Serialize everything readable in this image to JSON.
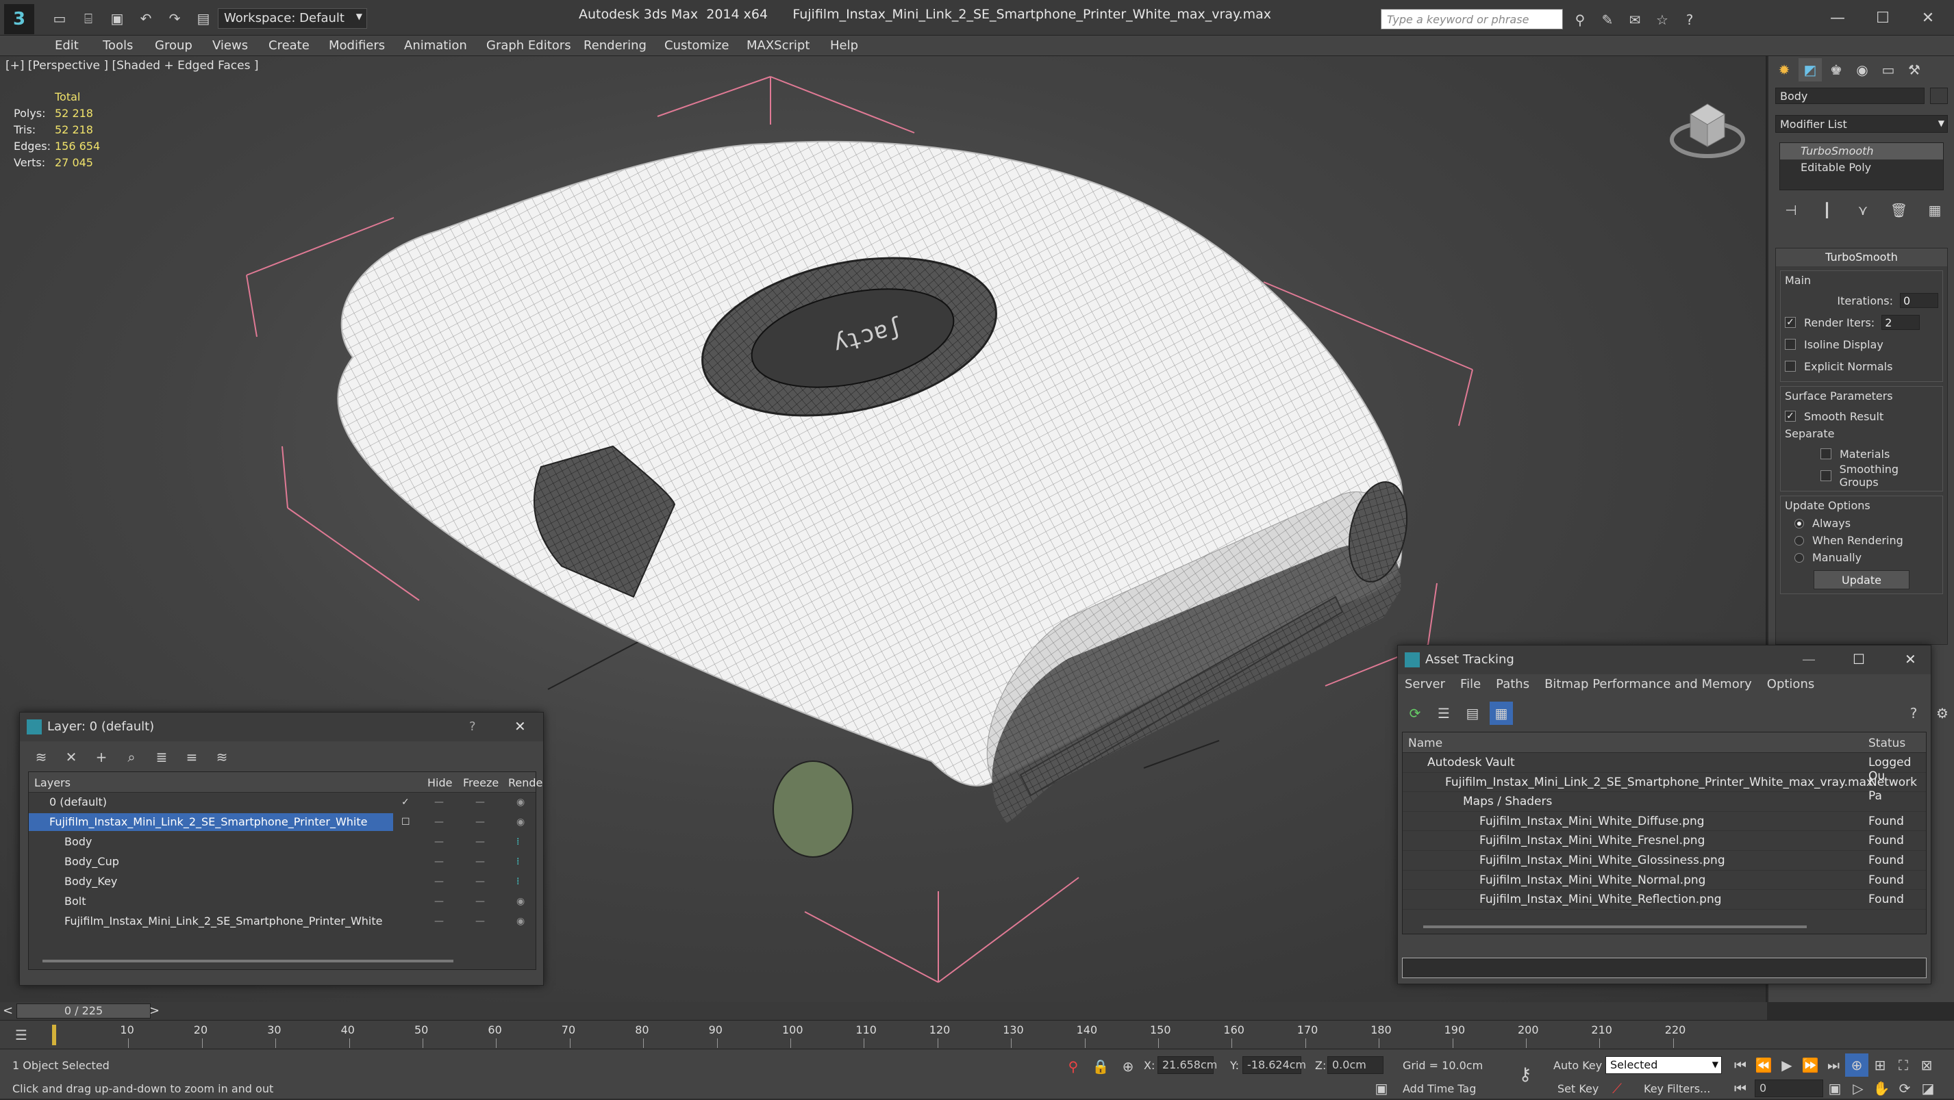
{
  "titlebar": {
    "workspace": "Workspace: Default",
    "app_title": "Autodesk 3ds Max  2014 x64",
    "file_title": "Fujifilm_Instax_Mini_Link_2_SE_Smartphone_Printer_White_max_vray.max",
    "search_placeholder": "Type a keyword or phrase"
  },
  "menu": [
    "Edit",
    "Tools",
    "Group",
    "Views",
    "Create",
    "Modifiers",
    "Animation",
    "Graph Editors",
    "Rendering",
    "Customize",
    "MAXScript",
    "Help"
  ],
  "viewport": {
    "label": "[+] [Perspective ] [Shaded + Edged Faces ]",
    "stats_header": "Total",
    "stats": [
      {
        "label": "Polys:",
        "value": "52 218"
      },
      {
        "label": "Tris:",
        "value": "52 218"
      },
      {
        "label": "Edges:",
        "value": "156 654"
      },
      {
        "label": "Verts:",
        "value": "27 045"
      }
    ]
  },
  "command_panel": {
    "object_name": "Body",
    "modifier_list": "Modifier List",
    "stack": [
      "TurboSmooth",
      "Editable Poly"
    ],
    "turbosmooth": {
      "title": "TurboSmooth",
      "main_label": "Main",
      "iterations_label": "Iterations:",
      "iterations_value": "0",
      "render_iters_label": "Render Iters:",
      "render_iters_value": "2",
      "isoline_label": "Isoline Display",
      "explicit_normals_label": "Explicit Normals",
      "surface_params_label": "Surface Parameters",
      "smooth_result_label": "Smooth Result",
      "separate_label": "Separate",
      "materials_label": "Materials",
      "smoothing_groups_label": "Smoothing Groups",
      "update_options_label": "Update Options",
      "always_label": "Always",
      "when_rendering_label": "When Rendering",
      "manually_label": "Manually",
      "update_button": "Update"
    }
  },
  "layer_dialog": {
    "title": "Layer: 0 (default)",
    "help": "?",
    "columns": {
      "layers": "Layers",
      "hide": "Hide",
      "freeze": "Freeze",
      "render": "Rende"
    },
    "rows": [
      {
        "name": "0 (default)",
        "indent": 0
      },
      {
        "name": "Fujifilm_Instax_Mini_Link_2_SE_Smartphone_Printer_White",
        "indent": 0
      },
      {
        "name": "Body",
        "indent": 1
      },
      {
        "name": "Body_Cup",
        "indent": 1
      },
      {
        "name": "Body_Key",
        "indent": 1
      },
      {
        "name": "Bolt",
        "indent": 1
      },
      {
        "name": "Fujifilm_Instax_Mini_Link_2_SE_Smartphone_Printer_White",
        "indent": 1
      }
    ]
  },
  "asset_dialog": {
    "title": "Asset Tracking",
    "menu": [
      "Server",
      "File",
      "Paths",
      "Bitmap Performance and Memory",
      "Options"
    ],
    "columns": {
      "name": "Name",
      "status": "Status"
    },
    "rows": [
      {
        "name": "Autodesk Vault",
        "status": "Logged Ou"
      },
      {
        "name": "Fujifilm_Instax_Mini_Link_2_SE_Smartphone_Printer_White_max_vray.max",
        "status": "Network Pa"
      },
      {
        "name": "Maps / Shaders",
        "status": ""
      },
      {
        "name": "Fujifilm_Instax_Mini_White_Diffuse.png",
        "status": "Found"
      },
      {
        "name": "Fujifilm_Instax_Mini_White_Fresnel.png",
        "status": "Found"
      },
      {
        "name": "Fujifilm_Instax_Mini_White_Glossiness.png",
        "status": "Found"
      },
      {
        "name": "Fujifilm_Instax_Mini_White_Normal.png",
        "status": "Found"
      },
      {
        "name": "Fujifilm_Instax_Mini_White_Reflection.png",
        "status": "Found"
      }
    ]
  },
  "timeline": {
    "frame_display": "0 / 225",
    "ticks": [
      "10",
      "20",
      "30",
      "40",
      "50",
      "60",
      "70",
      "80",
      "90",
      "100",
      "110",
      "120",
      "130",
      "140",
      "150",
      "160",
      "170",
      "180",
      "190",
      "200",
      "210",
      "220"
    ]
  },
  "status": {
    "selection": "1 Object Selected",
    "prompt": "Click and drag up-and-down to zoom in and out",
    "x_label": "X:",
    "x_value": "21.658cm",
    "y_label": "Y:",
    "y_value": "-18.624cm",
    "z_label": "Z:",
    "z_value": "0.0cm",
    "grid": "Grid = 10.0cm",
    "auto_key": "Auto Key",
    "selected_dropdown": "Selected",
    "set_key": "Set Key",
    "key_filters": "Key Filters...",
    "add_time_tag": "Add Time Tag",
    "current_frame": "0"
  }
}
